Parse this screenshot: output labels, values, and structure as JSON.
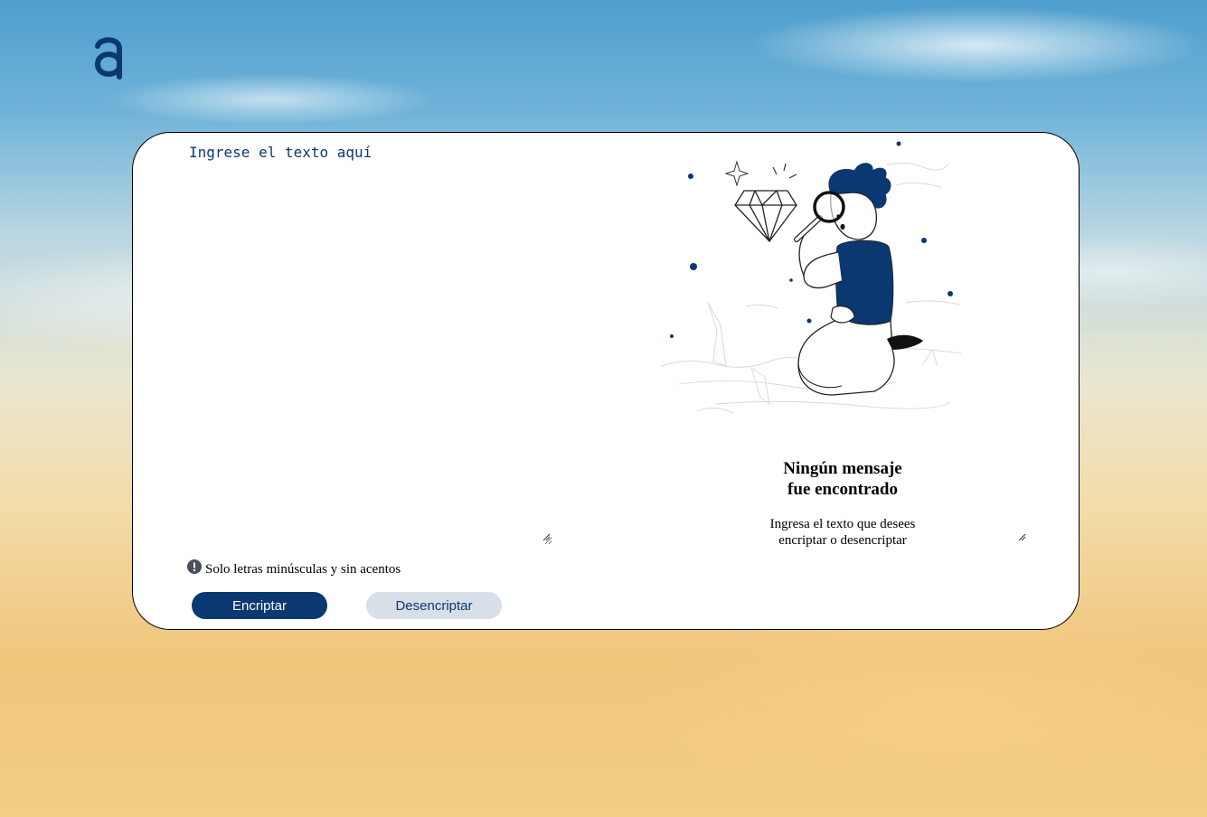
{
  "brand": {
    "logo_icon": "alura-a-logo-icon"
  },
  "input": {
    "placeholder": "Ingrese el texto aquí",
    "value": ""
  },
  "output": {
    "illustration": "person-with-magnifying-glass-illustration",
    "title_line1": "Ningún mensaje",
    "title_line2": "fue encontrado",
    "text_line1": "Ingresa el texto que desees",
    "text_line2": "encriptar o desencriptar"
  },
  "notice": {
    "icon": "exclamation-circle-icon",
    "text": "Solo letras minúsculas y sin acentos"
  },
  "buttons": {
    "encrypt_label": "Encriptar",
    "decrypt_label": "Desencriptar"
  },
  "colors": {
    "primary": "#0a3871",
    "secondary_button": "#d8dfe8",
    "card": "#ffffff"
  }
}
